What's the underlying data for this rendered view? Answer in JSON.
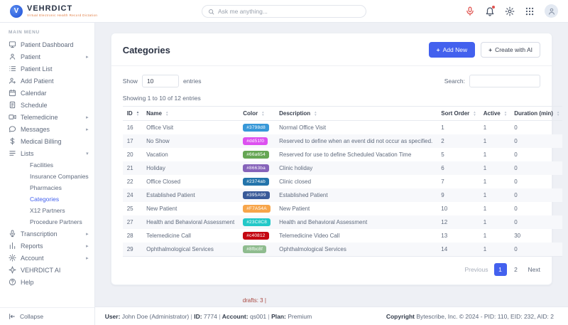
{
  "header": {
    "brand": {
      "name": "VEHRDICT",
      "tagline": "Virtual Electronic Health Record Dictation"
    },
    "search": {
      "placeholder": "Ask me anything..."
    }
  },
  "colors": {
    "accent": "#4361ee",
    "mic_red": "#e0524e",
    "tagline_orange": "#e07a3f",
    "active_link": "#4361ee",
    "row_stripe": "#f7f8fb"
  },
  "sidebar": {
    "section_label": "MAIN MENU",
    "collapse_label": "Collapse",
    "items": [
      {
        "label": "Patient Dashboard",
        "icon": "dashboard-icon",
        "chevron": false
      },
      {
        "label": "Patient",
        "icon": "patient-icon",
        "chevron": true
      },
      {
        "label": "Patient List",
        "icon": "patient-list-icon",
        "chevron": false
      },
      {
        "label": "Add Patient",
        "icon": "add-patient-icon",
        "chevron": false
      },
      {
        "label": "Calendar",
        "icon": "calendar-icon",
        "chevron": false
      },
      {
        "label": "Schedule",
        "icon": "schedule-icon",
        "chevron": false
      },
      {
        "label": "Telemedicine",
        "icon": "telemedicine-icon",
        "chevron": true
      },
      {
        "label": "Messages",
        "icon": "messages-icon",
        "chevron": true
      },
      {
        "label": "Medical Billing",
        "icon": "billing-icon",
        "chevron": false
      },
      {
        "label": "Lists",
        "icon": "lists-icon",
        "chevron": true,
        "expanded": true,
        "children": [
          "Facilities",
          "Insurance Companies",
          "Pharmacies",
          "Categories",
          "X12 Partners",
          "Procedure Partners"
        ],
        "active_child": "Categories"
      },
      {
        "label": "Transcription",
        "icon": "transcription-icon",
        "chevron": true
      },
      {
        "label": "Reports",
        "icon": "reports-icon",
        "chevron": true
      },
      {
        "label": "Account",
        "icon": "account-icon",
        "chevron": true
      },
      {
        "label": "VEHRDICT AI",
        "icon": "ai-icon",
        "chevron": false
      },
      {
        "label": "Help",
        "icon": "help-icon",
        "chevron": false
      }
    ]
  },
  "main": {
    "title": "Categories",
    "buttons": {
      "add_new": "Add New",
      "create_ai": "Create with AI"
    },
    "show_entries": {
      "prefix": "Show",
      "value": "10",
      "suffix": "entries"
    },
    "search_label": "Search:",
    "showing_text": "Showing 1 to 10 of 12 entries",
    "table": {
      "columns": [
        "ID",
        "Name",
        "Color",
        "Description",
        "Sort Order",
        "Active",
        "Duration (min)"
      ],
      "rows": [
        {
          "id": 16,
          "name": "Office Visit",
          "color": "#3798d8",
          "description": "Normal Office Visit",
          "sort_order": 1,
          "active": 1,
          "duration": 0
        },
        {
          "id": 17,
          "name": "No Show",
          "color": "#dd51f0",
          "description": "Reserved to define when an event did not occur as specified.",
          "sort_order": 2,
          "active": 1,
          "duration": 0
        },
        {
          "id": 20,
          "name": "Vacation",
          "color": "#66a654",
          "description": "Reserved for use to define Scheduled Vacation Time",
          "sort_order": 5,
          "active": 1,
          "duration": 0
        },
        {
          "id": 21,
          "name": "Holiday",
          "color": "#8663ba",
          "description": "Clinic holiday",
          "sort_order": 6,
          "active": 1,
          "duration": 0
        },
        {
          "id": 22,
          "name": "Office Closed",
          "color": "#2374ab",
          "description": "Clinic closed",
          "sort_order": 7,
          "active": 1,
          "duration": 0
        },
        {
          "id": 24,
          "name": "Established Patient",
          "color": "#395A99",
          "description": "Established Patient",
          "sort_order": 9,
          "active": 1,
          "duration": 0
        },
        {
          "id": 25,
          "name": "New Patient",
          "color": "#F7A54A",
          "description": "New Patient",
          "sort_order": 10,
          "active": 1,
          "duration": 0
        },
        {
          "id": 27,
          "name": "Health and Behavioral Assessment",
          "color": "#23C8C8",
          "description": "Health and Behavioral Assessment",
          "sort_order": 12,
          "active": 1,
          "duration": 0
        },
        {
          "id": 28,
          "name": "Telemedicine Call",
          "color": "#c40812",
          "description": "Telemedicine Video Call",
          "sort_order": 13,
          "active": 1,
          "duration": 30
        },
        {
          "id": 29,
          "name": "Ophthalmological Services",
          "color": "#8fbc8f",
          "description": "Ophthalmological Services",
          "sort_order": 14,
          "active": 1,
          "duration": 0
        }
      ]
    },
    "pagination": {
      "previous": "Previous",
      "pages": [
        "1",
        "2"
      ],
      "active_page": "1",
      "next": "Next"
    }
  },
  "footer": {
    "drafts": "drafts: 3 |",
    "user_info": [
      {
        "label": "User:",
        "value": "John Doe (Administrator)"
      },
      {
        "label": "ID:",
        "value": "7774"
      },
      {
        "label": "Account:",
        "value": "qs001"
      },
      {
        "label": "Plan:",
        "value": "Premium"
      }
    ],
    "copyright": {
      "label": "Copyright",
      "text": " Bytescribe, Inc. © 2024 - PID: 110, EID: 232, AID: 2"
    }
  }
}
